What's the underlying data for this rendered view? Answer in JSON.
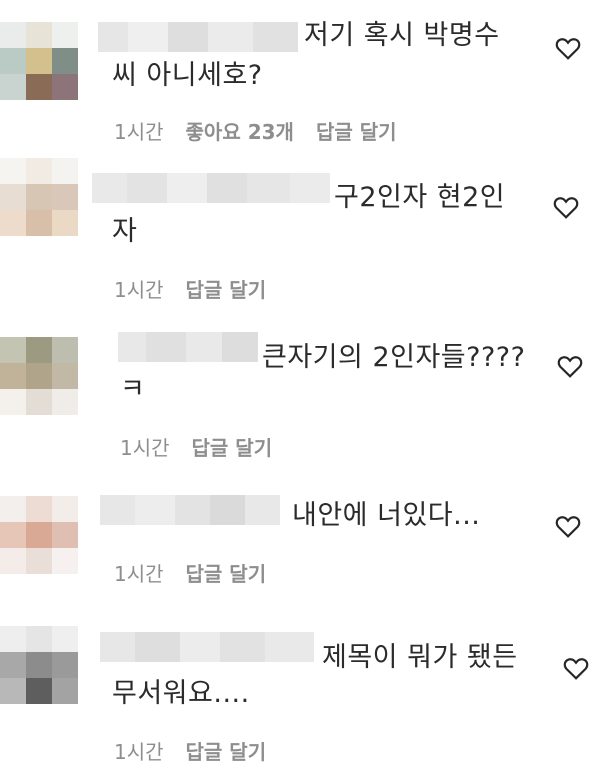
{
  "comments": [
    {
      "line1": "저기 혹시 박명수",
      "line2": "씨 아니세호?",
      "time": "1시간",
      "likes": "좋아요 23개",
      "reply": "답글 달기"
    },
    {
      "line1": "구2인자 현2인",
      "line2": "자",
      "time": "1시간",
      "reply": "답글 달기"
    },
    {
      "line1": "큰자기의 2인자들????",
      "line2": "ㅋ",
      "time": "1시간",
      "reply": "답글 달기"
    },
    {
      "line1": "내안에 너있다...",
      "time": "1시간",
      "reply": "답글 달기"
    },
    {
      "line1": "제목이 뭐가 됐든",
      "line2": "무서워요....",
      "time": "1시간",
      "reply": "답글 달기"
    }
  ]
}
